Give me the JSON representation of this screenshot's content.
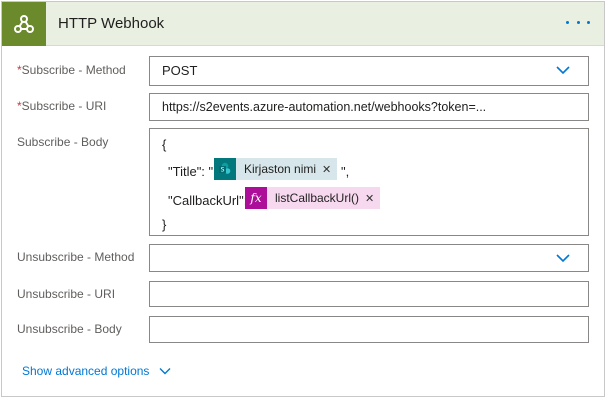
{
  "header": {
    "title": "HTTP Webhook",
    "icon": "webhook-icon",
    "menu_icon": "more-options-icon",
    "icon_bg": "#6b8a2c",
    "header_bg": "#e9efe1"
  },
  "fields": {
    "subscribe_method": {
      "required_mark": "*",
      "label": "Subscribe - Method",
      "value": "POST"
    },
    "subscribe_uri": {
      "required_mark": "*",
      "label": "Subscribe - URI",
      "value": "https://s2events.azure-automation.net/webhooks?token=..."
    },
    "subscribe_body": {
      "label": "Subscribe - Body",
      "open_brace": "{",
      "title_key": "\"Title\": \"",
      "title_suffix": "\",",
      "callback_key": "\"CallbackUrl\":",
      "close_brace": "}",
      "title_token": {
        "label": "Kirjaston nimi",
        "icon": "sharepoint-icon",
        "color": "#03787c"
      },
      "callback_token": {
        "label": "listCallbackUrl()",
        "icon_text": "fx",
        "icon": "expression-icon",
        "color": "#ad0e99"
      }
    },
    "unsubscribe_method": {
      "label": "Unsubscribe - Method",
      "value": ""
    },
    "unsubscribe_uri": {
      "label": "Unsubscribe - URI",
      "value": ""
    },
    "unsubscribe_body": {
      "label": "Unsubscribe - Body",
      "value": ""
    }
  },
  "advanced": {
    "label": "Show advanced options"
  },
  "accent_color": "#0078d4",
  "required_color": "#d13438"
}
